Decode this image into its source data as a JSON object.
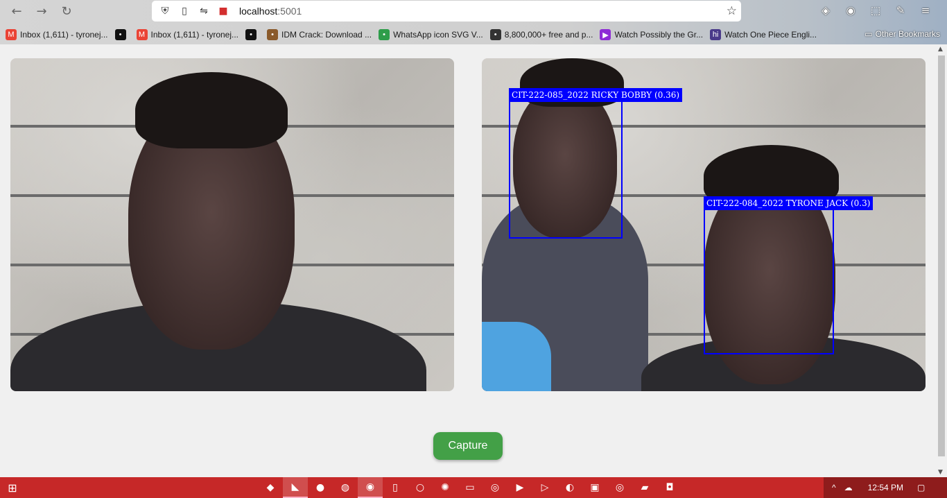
{
  "browser": {
    "url_host": "localhost",
    "url_port": ":5001",
    "bookmarks": [
      {
        "label": "Inbox (1,611) - tyronej...",
        "icon": "gmail-icon",
        "color": "#ea4335"
      },
      {
        "label": "",
        "icon": "camera-icon",
        "color": "#111111"
      },
      {
        "label": "Inbox (1,611) - tyronej...",
        "icon": "gmail-icon",
        "color": "#ea4335"
      },
      {
        "label": "",
        "icon": "camera-icon",
        "color": "#111111"
      },
      {
        "label": "IDM Crack: Download ...",
        "icon": "idm-icon",
        "color": "#8a5a2b"
      },
      {
        "label": "WhatsApp icon SVG V...",
        "icon": "svg-icon",
        "color": "#2e9d4a"
      },
      {
        "label": "8,800,000+ free and p...",
        "icon": "eye-icon",
        "color": "#333333"
      },
      {
        "label": "Watch Possibly the Gr...",
        "icon": "play-icon",
        "color": "#8e2bd6"
      },
      {
        "label": "Watch One Piece Engli...",
        "icon": "hi-icon",
        "color": "#4a3a8a"
      }
    ],
    "other_bookmarks": "Other Bookmarks"
  },
  "detections": [
    {
      "label": "CIT-222-085_2022 RICKY BOBBY (0.36)"
    },
    {
      "label": "CIT-222-084_2022 TYRONE JACK (0.3)"
    }
  ],
  "capture_label": "Capture",
  "taskbar": {
    "time": "12:54 PM",
    "accent": "#c62828"
  }
}
